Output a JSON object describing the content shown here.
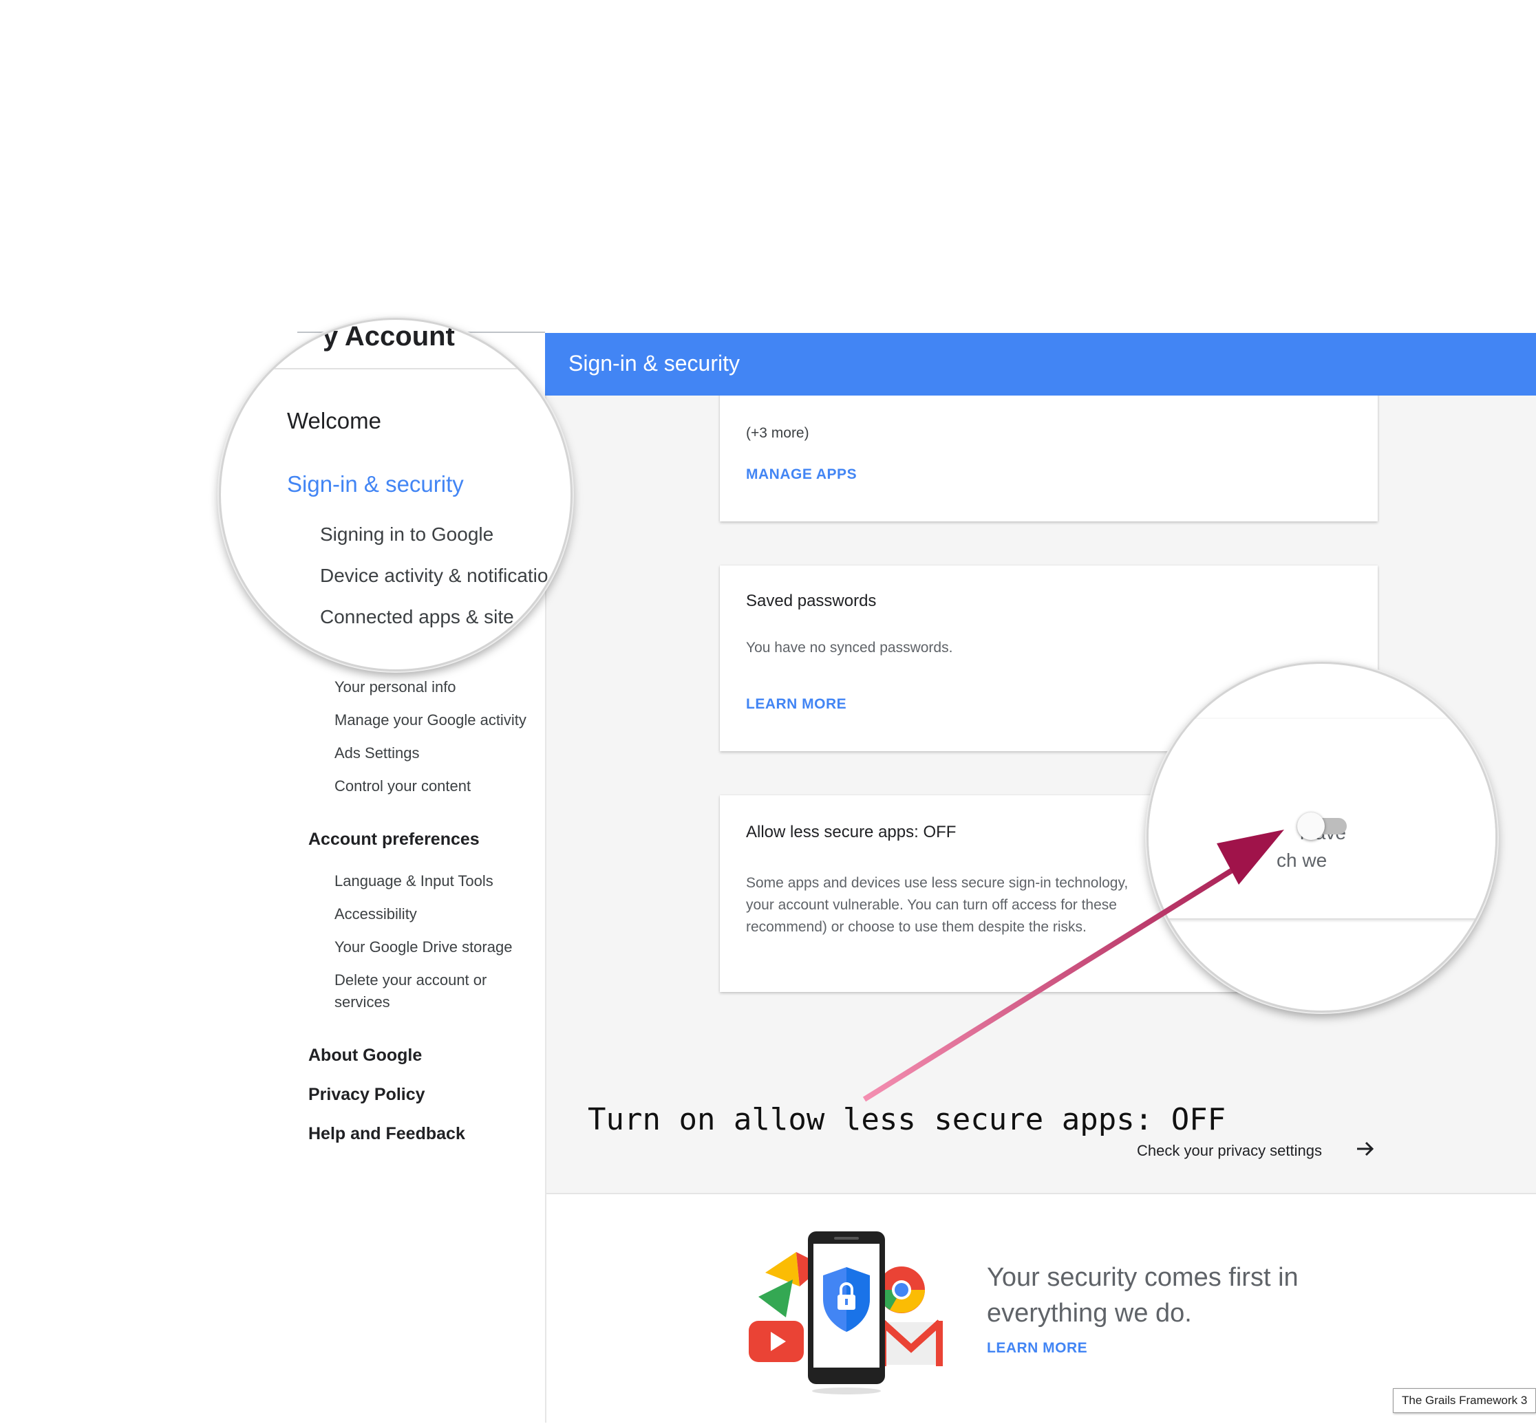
{
  "header": {
    "title": "Sign-in & security"
  },
  "sidebar": {
    "app_title_fragment": "y Account",
    "welcome": "Welcome",
    "active_section": "Sign-in & security",
    "security_items": [
      "Signing in to Google",
      "Device activity & notificatio",
      "Connected apps & site"
    ],
    "privacy_items": [
      "Your personal info",
      "Manage your Google activity",
      "Ads Settings",
      "Control your content"
    ],
    "account_preferences": "Account preferences",
    "preference_items": [
      "Language & Input Tools",
      "Accessibility",
      "Your Google Drive storage",
      "Delete your account or",
      "services"
    ],
    "about_google": "About Google",
    "privacy_policy": "Privacy Policy",
    "help_feedback": "Help and Feedback"
  },
  "apps_card": {
    "more_count": "(+3 more)",
    "manage_apps": "MANAGE APPS"
  },
  "passwords_card": {
    "title": "Saved passwords",
    "text": "You have no synced passwords.",
    "learn_more": "LEARN MORE"
  },
  "less_secure_card": {
    "title": "Allow less secure apps: OFF",
    "line1": "Some apps and devices use less secure sign-in technology,",
    "line2": "your account vulnerable. You can turn off access for these",
    "line3": "recommend) or choose to use them despite the risks.",
    "toggle_on": false
  },
  "zoom_fragments": {
    "line1_end": "leave",
    "line2_end": "ch we"
  },
  "annotation": "Turn on allow less secure apps: OFF",
  "privacy_check": {
    "label": "Check your privacy settings",
    "icon": "arrow-right-icon"
  },
  "footer_promo": {
    "headline_line1": "Your security comes first in",
    "headline_line2": "everything we do.",
    "learn_more": "LEARN MORE"
  },
  "tooltip": "The Grails Framework 3",
  "colors": {
    "accent": "#4285f4",
    "arrow": "#c2185b"
  }
}
